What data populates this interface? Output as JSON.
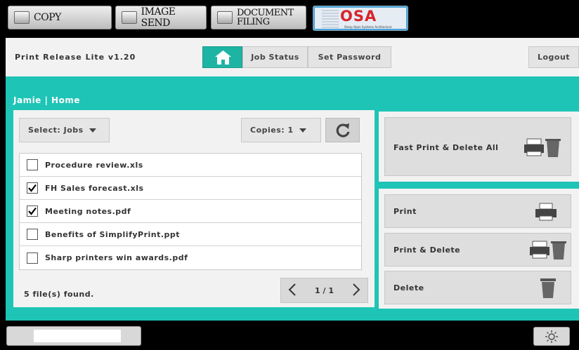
{
  "modes": {
    "copy": "COPY",
    "image_send": "IMAGE SEND",
    "document_filing_1": "DOCUMENT",
    "document_filing_2": "FILING",
    "osa_logo": "OSA",
    "osa_subtitle": "Sharp Open Systems Architecture"
  },
  "header": {
    "app_title": "Print Release Lite  v1.20",
    "job_status": "Job Status",
    "set_password": "Set Password",
    "logout": "Logout"
  },
  "breadcrumb": "Jamie | Home",
  "controls": {
    "select_jobs": "Select: Jobs",
    "copies": "Copies: 1"
  },
  "files": [
    {
      "name": "Procedure review.xls",
      "checked": false
    },
    {
      "name": "FH Sales forecast.xls",
      "checked": true
    },
    {
      "name": "Meeting notes.pdf",
      "checked": true
    },
    {
      "name": "Benefits of SimplifyPrint.ppt",
      "checked": false
    },
    {
      "name": "Sharp printers win awards.pdf",
      "checked": false
    }
  ],
  "footer": {
    "found": "5 file(s) found.",
    "page": "1 / 1"
  },
  "actions": {
    "fast_print_delete_all": "Fast Print & Delete All",
    "print": "Print",
    "print_delete": "Print & Delete",
    "delete": "Delete"
  },
  "colors": {
    "teal": "#1ec4b6",
    "home_button": "#1eb4a4",
    "panel": "#f2f2f2"
  }
}
